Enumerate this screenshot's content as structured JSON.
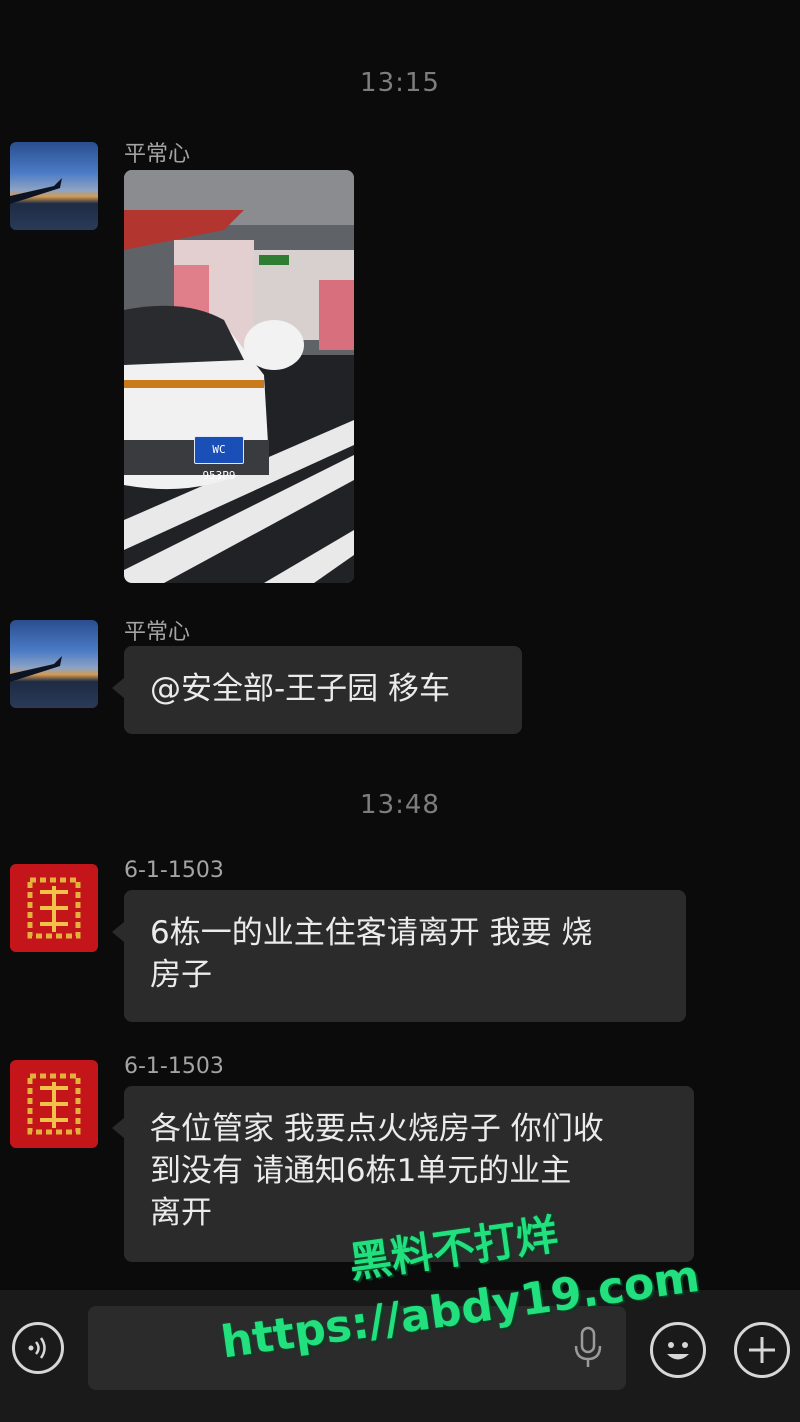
{
  "chat": {
    "timestamps": [
      "13:15",
      "13:48"
    ],
    "messages": [
      {
        "sender": "平常心",
        "type": "image",
        "plate": "WC 953P9"
      },
      {
        "sender": "平常心",
        "type": "text",
        "text": "@安全部-王子园 移车"
      },
      {
        "sender": "6-1-1503",
        "type": "text",
        "line1": "6栋一的业主住客请离开 我要 烧",
        "line2": "房子"
      },
      {
        "sender": "6-1-1503",
        "type": "text",
        "line1": "各位管家 我要点火烧房子 你们收",
        "line2": "到没有 请通知6栋1单元的业主",
        "line3": "离开"
      }
    ]
  },
  "watermark": {
    "line1": "黑料不打烊",
    "line2": "https://abdy19.com"
  },
  "input_bar": {
    "voice_icon": "voice-icon",
    "mic_icon": "mic-icon",
    "emoji_icon": "emoji-icon",
    "plus_icon": "plus-icon"
  },
  "colors": {
    "background": "#0b0b0b",
    "bubble": "#2b2b2b",
    "watermark": "#22e07e"
  }
}
